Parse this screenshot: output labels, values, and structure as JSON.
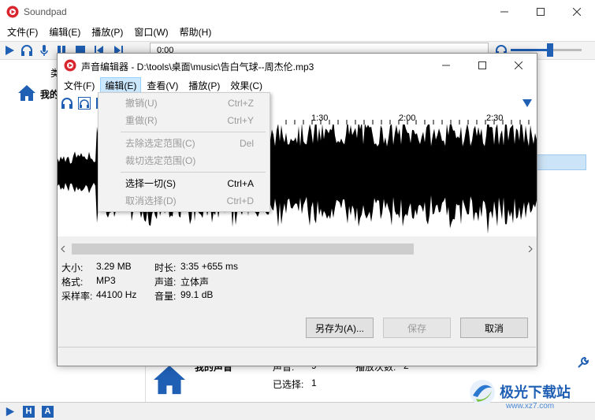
{
  "main_window": {
    "title": "Soundpad",
    "menu": [
      "文件(F)",
      "编辑(E)",
      "播放(P)",
      "窗口(W)",
      "帮助(H)"
    ],
    "time_display": "0:00",
    "left_panel": {
      "header_partial": "类",
      "item_partial": "我的"
    },
    "bottom_stats": {
      "label_left": "我的声音",
      "label_mid": "声音:",
      "count_mid": "9",
      "label_right": "播放次数:",
      "count_right": "2",
      "selected_label": "已选择:",
      "selected_count": "1"
    },
    "status_buttons": [
      "H",
      "A"
    ],
    "volume": 0.55
  },
  "dialog": {
    "title": "声音编辑器 - D:\\tools\\桌面\\music\\告白气球--周杰伦.mp3",
    "menu": [
      "文件(F)",
      "编辑(E)",
      "查看(V)",
      "播放(P)",
      "效果(C)"
    ],
    "timeline_labels": [
      "1:30",
      "2:00",
      "2:30"
    ],
    "info": {
      "size_label": "大小:",
      "size_value": "3.29 MB",
      "format_label": "格式:",
      "format_value": "MP3",
      "rate_label": "采样率:",
      "rate_value": "44100 Hz",
      "duration_label": "时长:",
      "duration_value": "3:35 +655 ms",
      "channel_label": "声道:",
      "channel_value": "立体声",
      "volume_label": "音量:",
      "volume_value": "99.1 dB"
    },
    "buttons": {
      "save_as": "另存为(A)...",
      "save": "保存",
      "cancel": "取消"
    }
  },
  "edit_menu": {
    "items": [
      {
        "label": "撤销(U)",
        "shortcut": "Ctrl+Z",
        "enabled": false
      },
      {
        "label": "重做(R)",
        "shortcut": "Ctrl+Y",
        "enabled": false
      },
      {
        "label": "去除选定范围(C)",
        "shortcut": "Del",
        "enabled": false
      },
      {
        "label": "裁切选定范围(O)",
        "shortcut": "",
        "enabled": false
      },
      {
        "label": "选择一切(S)",
        "shortcut": "Ctrl+A",
        "enabled": true
      },
      {
        "label": "取消选择(D)",
        "shortcut": "Ctrl+D",
        "enabled": false
      }
    ]
  },
  "watermark": {
    "brand": "极光下载站",
    "url": "www.xz7.com"
  },
  "colors": {
    "accent": "#1f5fb4",
    "logo_red": "#d9262e",
    "menu_highlight": "#cce8ff"
  }
}
